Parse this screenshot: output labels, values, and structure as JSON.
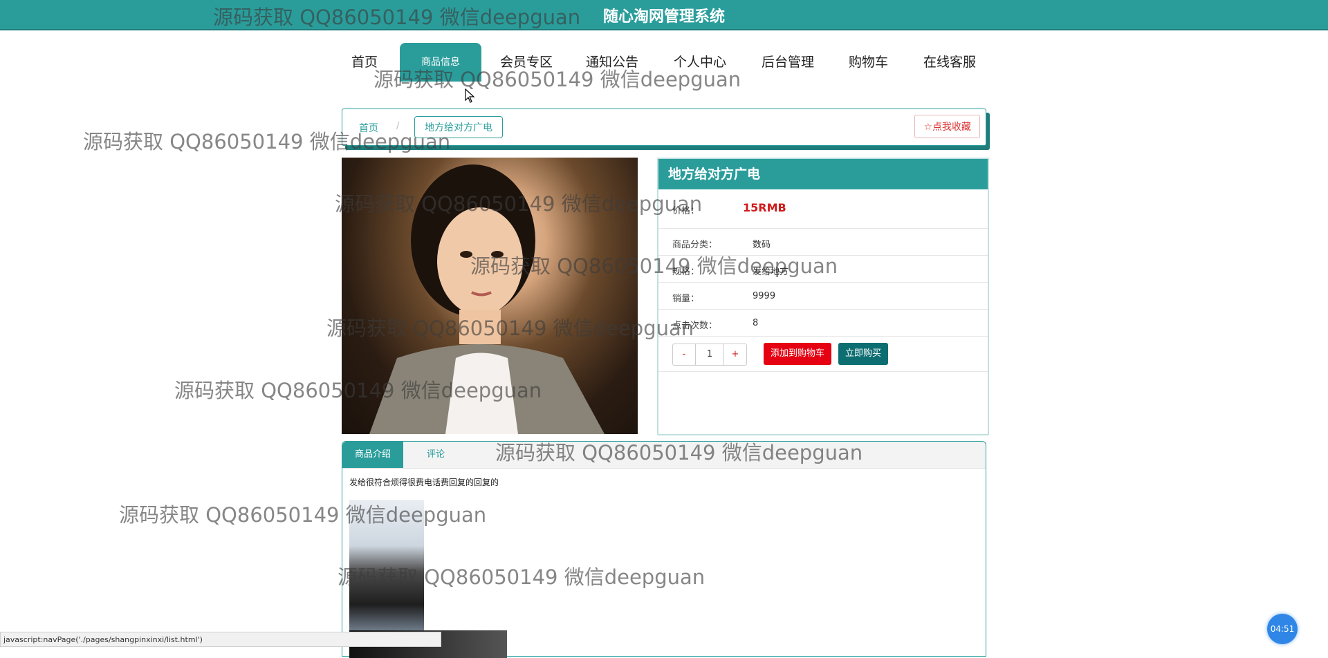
{
  "header": {
    "title": "随心淘网管理系统"
  },
  "nav": {
    "items": [
      {
        "label": "首页"
      },
      {
        "label": "商品信息"
      },
      {
        "label": "会员专区"
      },
      {
        "label": "通知公告"
      },
      {
        "label": "个人中心"
      },
      {
        "label": "后台管理"
      },
      {
        "label": "购物车"
      },
      {
        "label": "在线客服"
      }
    ],
    "active_index": 1
  },
  "breadcrumb": {
    "home": "首页",
    "separator": "/",
    "current": "地方给对方广电"
  },
  "favorite_button": "☆点我收藏",
  "product": {
    "name": "地方给对方广电",
    "price_label": "价格：",
    "price": "15RMB",
    "fields": [
      {
        "label": "商品分类：",
        "value": "数码"
      },
      {
        "label": "规格：",
        "value": "发给地方"
      },
      {
        "label": "销量：",
        "value": "9999"
      },
      {
        "label": "点击次数：",
        "value": "8"
      }
    ],
    "quantity": {
      "minus": "-",
      "value": "1",
      "plus": "+"
    },
    "add_to_cart": "添加到购物车",
    "buy_now": "立即购买"
  },
  "tabs": {
    "items": [
      {
        "label": "商品介绍"
      },
      {
        "label": "评论"
      }
    ],
    "active_index": 0,
    "description_text": "发给很符合烦得很费电话费回复的回复的"
  },
  "status_bar": {
    "text": "javascript:navPage('./pages/shangpinxinxi/list.html')"
  },
  "timer": {
    "text": "04:51"
  },
  "watermark": {
    "text": "源码获取 QQ86050149 微信deepguan"
  },
  "colors": {
    "primary": "#2a9d9b",
    "price": "#d01a1a",
    "cart_button": "#e50012",
    "buy_button": "#0d6e72"
  }
}
